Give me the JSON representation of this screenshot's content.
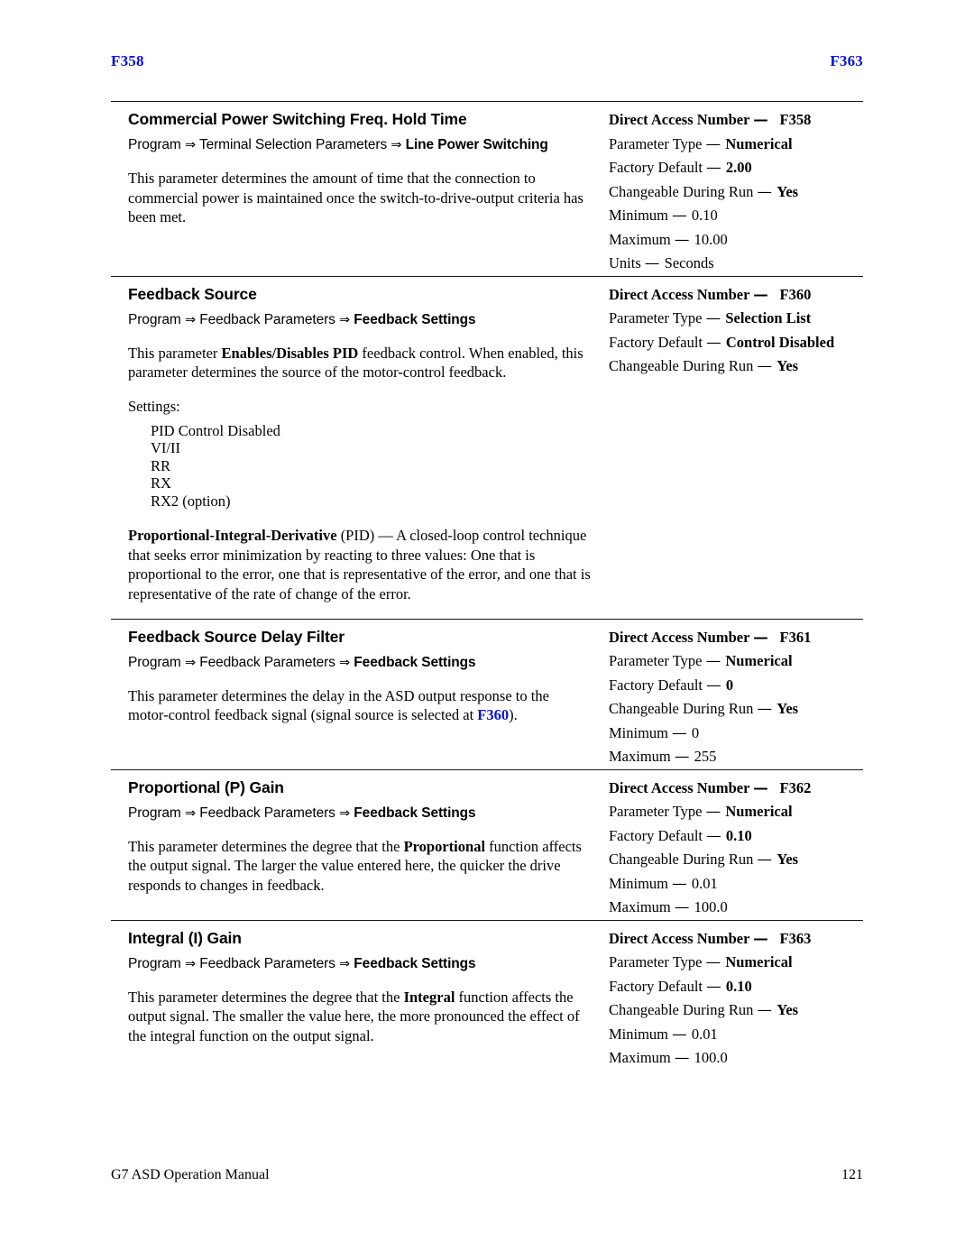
{
  "running_head": {
    "left": "F358",
    "right": "F363",
    "color": "#0a14c8"
  },
  "footer": {
    "manual_title": "G7 ASD Operation Manual",
    "page_number": "121"
  },
  "spec_labels": {
    "direct_access_number": "Direct Access Number",
    "parameter_type": "Parameter Type",
    "factory_default": "Factory Default",
    "changeable_during_run": "Changeable During Run",
    "minimum": "Minimum",
    "maximum": "Maximum",
    "units": "Units",
    "dash": "—"
  },
  "arrow_glyph": "⇒",
  "sections": [
    {
      "title": "Commercial Power Switching Freq. Hold Time",
      "breadcrumb": {
        "root": "Program",
        "middle": "Terminal Selection Parameters",
        "last": "Line Power Switching"
      },
      "description_parts": [
        {
          "text": "This parameter determines the amount of time that the connection to commercial power is maintained once the switch-to-drive-output criteria has been met.",
          "bold": false
        }
      ],
      "spec": {
        "direct_access_number": "F358",
        "parameter_type": "Numerical",
        "factory_default": "2.00",
        "changeable_during_run": "Yes",
        "minimum": "0.10",
        "maximum": "10.00",
        "units": "Seconds"
      }
    },
    {
      "title": "Feedback Source",
      "breadcrumb": {
        "root": "Program",
        "middle": "Feedback Parameters",
        "last": "Feedback Settings"
      },
      "description_parts": [
        {
          "text": "This parameter ",
          "bold": false
        },
        {
          "text": "Enables/Disables PID",
          "bold": true
        },
        {
          "text": " feedback control. When enabled, this parameter determines the source of the motor-control feedback.",
          "bold": false
        }
      ],
      "settings_label": "Settings:",
      "settings": [
        "PID Control Disabled",
        "VI/II",
        "RR",
        "RX",
        "RX2 (option)"
      ],
      "definition_parts": [
        {
          "text": "Proportional-Integral-Derivative",
          "bold": true
        },
        {
          "text": " (PID) — A closed-loop control technique that seeks error minimization by reacting to three values: One that is proportional to the error, one that is representative of the error, and one that is representative of the rate of change of the error.",
          "bold": false
        }
      ],
      "spec": {
        "direct_access_number": "F360",
        "parameter_type": "Selection List",
        "factory_default": "Control Disabled",
        "changeable_during_run": "Yes"
      }
    },
    {
      "title": "Feedback Source Delay Filter",
      "breadcrumb": {
        "root": "Program",
        "middle": "Feedback Parameters",
        "last": "Feedback Settings"
      },
      "description_parts": [
        {
          "text": "This parameter determines the delay in the ASD output response to the motor-control feedback signal (signal source is selected at ",
          "bold": false
        },
        {
          "text": "F360",
          "xref": true
        },
        {
          "text": ").",
          "bold": false
        }
      ],
      "spec": {
        "direct_access_number": "F361",
        "parameter_type": "Numerical",
        "factory_default": "0",
        "changeable_during_run": "Yes",
        "minimum": "0",
        "maximum": "255"
      }
    },
    {
      "title": "Proportional (P) Gain",
      "breadcrumb": {
        "root": "Program",
        "middle": "Feedback Parameters",
        "last": "Feedback Settings"
      },
      "description_parts": [
        {
          "text": "This parameter determines the degree that the ",
          "bold": false
        },
        {
          "text": "Proportional",
          "bold": true
        },
        {
          "text": " function affects the output signal. The larger the value entered here, the quicker the drive responds to changes in feedback.",
          "bold": false
        }
      ],
      "spec": {
        "direct_access_number": "F362",
        "parameter_type": "Numerical",
        "factory_default": "0.10",
        "changeable_during_run": "Yes",
        "minimum": "0.01",
        "maximum": "100.0"
      }
    },
    {
      "title": "Integral (I) Gain",
      "breadcrumb": {
        "root": "Program",
        "middle": "Feedback Parameters",
        "last": "Feedback Settings"
      },
      "description_parts": [
        {
          "text": "This parameter determines the degree that the ",
          "bold": false
        },
        {
          "text": "Integral",
          "bold": true
        },
        {
          "text": " function affects the output signal. The smaller the value here, the more pronounced the effect of the integral function on the output signal.",
          "bold": false
        }
      ],
      "spec": {
        "direct_access_number": "F363",
        "parameter_type": "Numerical",
        "factory_default": "0.10",
        "changeable_during_run": "Yes",
        "minimum": "0.01",
        "maximum": "100.0"
      }
    }
  ]
}
